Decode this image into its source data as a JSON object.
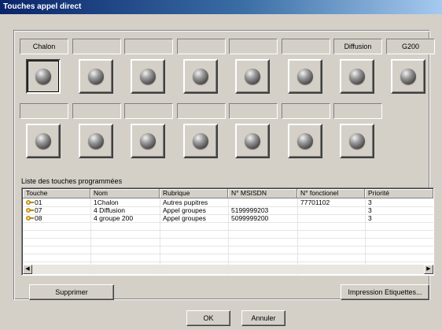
{
  "window": {
    "title": "Touches appel direct"
  },
  "top_row": {
    "labels": [
      "Chalon",
      "",
      "",
      "",
      "",
      "",
      "Diffusion",
      "G200"
    ]
  },
  "bottom_row": {
    "labels": [
      "",
      "",
      "",
      "",
      "",
      "",
      ""
    ]
  },
  "list": {
    "title": "Liste des touches programmées",
    "columns": [
      "Touche",
      "Nom",
      "Rubrique",
      "N° MSISDN",
      "N° fonctionel",
      "Priorité"
    ],
    "rows": [
      [
        "01",
        "1Chalon",
        "Autres pupitres",
        "",
        "77701102",
        "3"
      ],
      [
        "07",
        "4 Diffusion",
        "Appel groupes",
        "5199999203",
        "",
        "3"
      ],
      [
        "08",
        "4 groupe 200",
        "Appel groupes",
        "5099999200",
        "",
        "3"
      ]
    ]
  },
  "buttons": {
    "delete": "Supprimer",
    "print_labels": "Impression Etiquettes...",
    "ok": "OK",
    "cancel": "Annuler"
  },
  "icons": {
    "key_row": "key-icon",
    "call_button": "round-button-icon",
    "scroll_left": "arrow-left-icon",
    "scroll_right": "arrow-right-icon"
  },
  "colors": {
    "titlebar_start": "#0a246a",
    "titlebar_end": "#a6caf0",
    "face": "#d4d0c8"
  }
}
